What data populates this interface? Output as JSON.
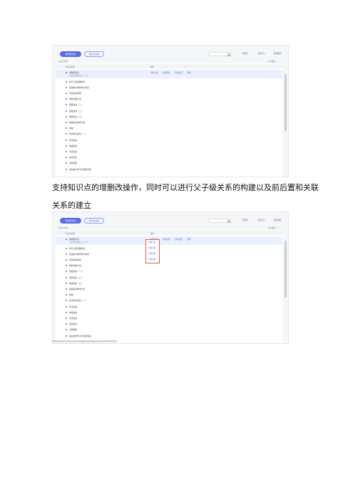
{
  "top_screenshot": {
    "toolbar": {
      "primary_btn": "新增知识点",
      "secondary_btn": "知识点关系",
      "search_placeholder": "",
      "link1": "一键展开",
      "link2": "批量导入",
      "link3": "批量删除"
    },
    "breadcrumb": "知识点管理",
    "right_info": "共有数据：1",
    "columns": [
      "知识点名称",
      "操作"
    ],
    "selected_row": {
      "label": "通用知识点",
      "sub": "父级  第1级知识点（1个）",
      "ops": [
        "新增子级",
        "新增前置",
        "新增后置",
        "删除"
      ]
    },
    "rows": [
      "单元认知基础知识",
      "基础体力教学评价体系",
      "专项运动教学",
      "体能训练方法",
      "田径运动（一）",
      "田径运动（二）",
      "球类运动（三）",
      "球类运动教学方法",
      "体操",
      "武术体育运动（一）",
      "武术运动",
      "球类运动",
      "冰雪运动",
      "运动养生",
      "竞赛组织",
      "运动技术学习与体能训练"
    ]
  },
  "caption": {
    "line1": "支持知识点的增删改操作，同时可以进行父子级关系的构建以及前后置和关联",
    "line2": "关系的建立"
  },
  "bottom_screenshot": {
    "context_menu": [
      "新增子级",
      "新增前置",
      "新增后置",
      "新增关联"
    ],
    "status_bar": "https://www.hzxq.com/course/knowledge/manage?type=1&courseId=2025070910"
  }
}
